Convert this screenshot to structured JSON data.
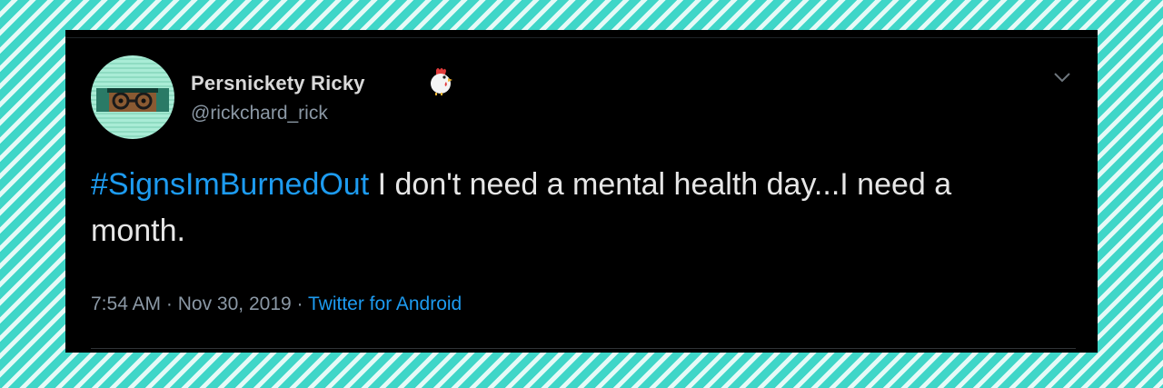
{
  "tweet": {
    "author": {
      "name": "Persnickety Ricky",
      "handle": "@rickchard_rick",
      "badge_icon": "rooster-emoji-icon",
      "avatar_icon": "avatar-icon"
    },
    "menu_icon": "chevron-down-icon",
    "hashtag": "#SignsImBurnedOut",
    "text": " I don't need a mental health day...I need a month.",
    "time": "7:54 AM",
    "separator": "·",
    "date": "Nov 30, 2019",
    "source": "Twitter for Android"
  },
  "colors": {
    "background_teal": "#3fd6c8",
    "card": "#000000",
    "link": "#1d9bf0",
    "secondary_text": "#8b98a5"
  }
}
